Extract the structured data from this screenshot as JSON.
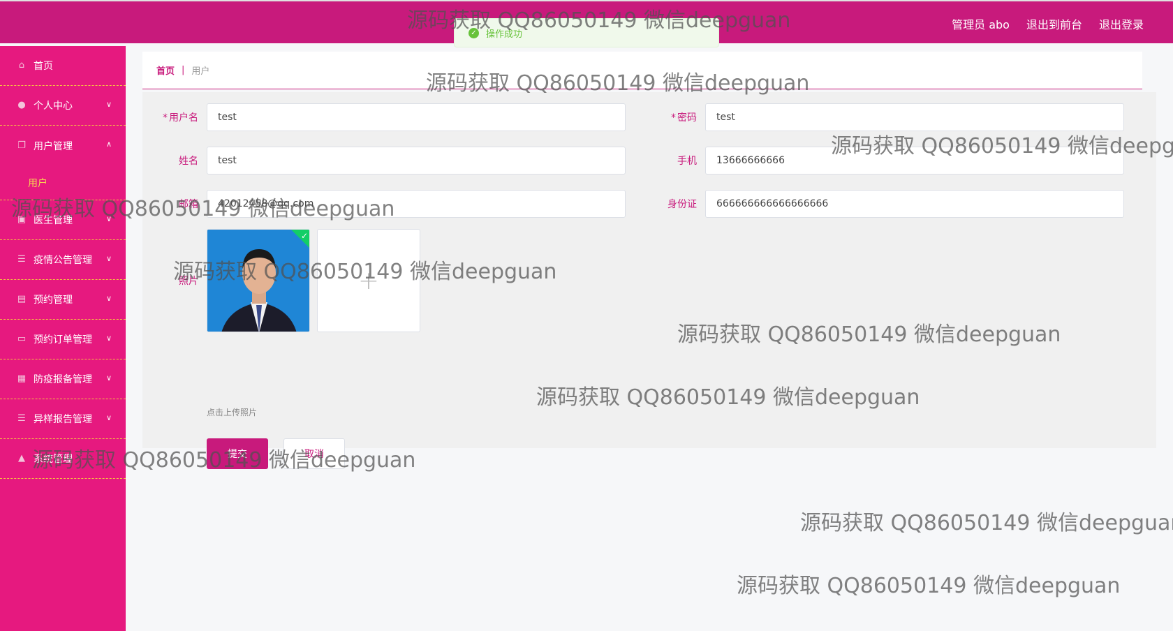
{
  "header": {
    "admin_label": "管理员 abo",
    "front_label": "退出到前台",
    "logout_label": "退出登录",
    "bg_color": "#c81a7c"
  },
  "toast": {
    "icon": "check-circle-icon",
    "text": "操作成功"
  },
  "sidebar": {
    "bg_color": "#e6197f",
    "items": [
      {
        "label": "首页",
        "icon": "home-icon"
      },
      {
        "label": "个人中心",
        "icon": "user-icon"
      },
      {
        "label": "用户管理",
        "icon": "copy-icon",
        "expanded": true,
        "sub": "用户"
      },
      {
        "label": "医生管理",
        "icon": "doctor-icon"
      },
      {
        "label": "疫情公告管理",
        "icon": "list-icon"
      },
      {
        "label": "预约管理",
        "icon": "clipboard-icon"
      },
      {
        "label": "预约订单管理",
        "icon": "chat-icon"
      },
      {
        "label": "防疫报备管理",
        "icon": "report-icon"
      },
      {
        "label": "异样报告管理",
        "icon": "list-icon"
      },
      {
        "label": "系统管理",
        "icon": "system-icon"
      }
    ]
  },
  "breadcrumb": {
    "home": "首页",
    "sep": "|",
    "current": "用户"
  },
  "form": {
    "username": {
      "label": "用户名",
      "value": "test"
    },
    "password": {
      "label": "密码",
      "value": "test"
    },
    "name": {
      "label": "姓名",
      "value": "test"
    },
    "phone": {
      "label": "手机",
      "value": "13666666666"
    },
    "email": {
      "label": "邮箱",
      "value": "42012458@qq.com"
    },
    "idcard": {
      "label": "身份证",
      "value": "666666666666666666"
    },
    "photo": {
      "label": "照片",
      "upload_plus": "+",
      "tip": "点击上传照片"
    },
    "submit_label": "提交",
    "cancel_label": "取消"
  },
  "watermark": "源码获取 QQ86050149 微信deepguan"
}
